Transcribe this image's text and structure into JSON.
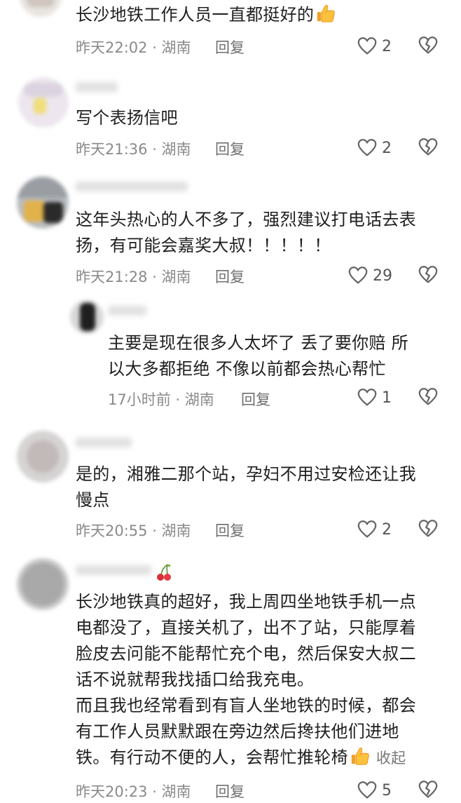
{
  "comments": [
    {
      "text": "长沙地铁工作人员一直都挺好的",
      "meta": "昨天22:02 · 湖南",
      "reply": "回复",
      "likes": "2",
      "emoji": "thumbs-up-icon"
    },
    {
      "text": "写个表扬信吧",
      "meta": "昨天21:36 · 湖南",
      "reply": "回复",
      "likes": "2"
    },
    {
      "text_line1": "这年头热心的人不多了，强烈建议打电话去表",
      "text_line2": "扬，有可能会嘉奖大叔！！！！！",
      "meta": "昨天21:28 · 湖南",
      "reply": "回复",
      "likes": "29"
    },
    {
      "text_line1": "主要是现在很多人太坏了 丢了要你赔 所",
      "text_line2": "以大多都拒绝 不像以前都会热心帮忙",
      "meta": "17小时前 · 湖南",
      "reply": "回复",
      "likes": "1"
    },
    {
      "text_line1": "是的，湘雅二那个站，孕妇不用过安检还让我",
      "text_line2": "慢点",
      "meta": "昨天20:55 · 湖南",
      "reply": "回复",
      "likes": "2"
    },
    {
      "lines": [
        "长沙地铁真的超好，我上周四坐地铁手机一点",
        "电都没了，直接关机了，出不了站，只能厚着",
        "脸皮去问能不能帮忙充个电，然后保安大叔二",
        "话不说就帮我找插口给我充电。",
        "而且我也经常看到有盲人坐地铁的时候，都会",
        "有工作人员默默跟在旁边然后搀扶他们进地",
        "铁。有行动不便的人，会帮忙推轮椅"
      ],
      "collapse": "收起",
      "meta": "昨天20:23 · 湖南",
      "reply": "回复",
      "likes": "5",
      "name_emoji": "cherry-icon"
    }
  ],
  "colors": {
    "text": "#1f1f1f",
    "meta": "#8a8a8a",
    "icon": "#666666"
  }
}
